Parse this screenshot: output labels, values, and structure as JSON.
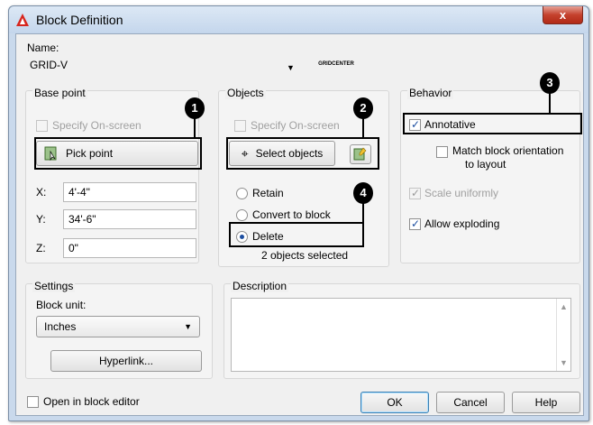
{
  "window": {
    "title": "Block Definition",
    "close_label": "x"
  },
  "name": {
    "label": "Name:",
    "value": "GRID-V",
    "preview_text": "GRIDCENTER"
  },
  "base_point": {
    "title": "Base point",
    "specify_label": "Specify On-screen",
    "pick_label": "Pick point",
    "x_label": "X:",
    "x_value": "4'-4\"",
    "y_label": "Y:",
    "y_value": "34'-6\"",
    "z_label": "Z:",
    "z_value": "0\""
  },
  "objects": {
    "title": "Objects",
    "specify_label": "Specify On-screen",
    "select_label": "Select objects",
    "retain_label": "Retain",
    "convert_label": "Convert to block",
    "delete_label": "Delete",
    "status": "2 objects selected"
  },
  "behavior": {
    "title": "Behavior",
    "annotative_label": "Annotative",
    "match_label_line1": "Match block orientation",
    "match_label_line2": "to layout",
    "scale_label": "Scale uniformly",
    "explode_label": "Allow exploding"
  },
  "settings": {
    "title": "Settings",
    "unit_label": "Block unit:",
    "unit_value": "Inches",
    "hyperlink_label": "Hyperlink..."
  },
  "description": {
    "title": "Description",
    "value": ""
  },
  "footer": {
    "open_editor_label": "Open in block editor",
    "ok_label": "OK",
    "cancel_label": "Cancel",
    "help_label": "Help"
  },
  "callouts": [
    "1",
    "2",
    "3",
    "4"
  ],
  "colors": {
    "accent": "#1d4ea0",
    "titlebar": "#c4d6ec",
    "close": "#c4412d",
    "dialog_bg": "#f0f0f0"
  }
}
